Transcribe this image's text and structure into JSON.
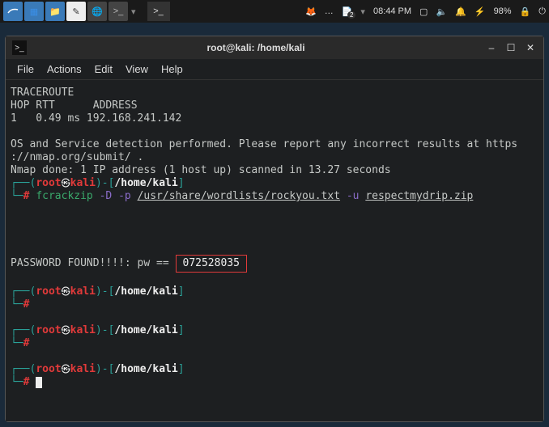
{
  "taskbar": {
    "time": "08:44 PM",
    "battery": "98%",
    "workspace_badge": "2"
  },
  "window": {
    "title": "root@kali: /home/kali"
  },
  "menu": {
    "file": "File",
    "actions": "Actions",
    "edit": "Edit",
    "view": "View",
    "help": "Help"
  },
  "output": {
    "traceroute_header": "TRACEROUTE",
    "traceroute_cols": "HOP RTT      ADDRESS",
    "traceroute_row": "1   0.49 ms 192.168.241.142",
    "os_detect_1": "OS and Service detection performed. Please report any incorrect results at https",
    "os_detect_2": "://nmap.org/submit/ .",
    "nmap_done": "Nmap done: 1 IP address (1 host up) scanned in 13.27 seconds",
    "password_found_label": "PASSWORD FOUND!!!!: pw == ",
    "password_value": "072528035"
  },
  "prompt": {
    "open": "┌──(",
    "user": "root",
    "at": "㉿",
    "host": "kali",
    "close_paren": ")",
    "dash": "-",
    "lb": "[",
    "path": "/home/kali",
    "rb": "]",
    "line2": "└─",
    "hash": "#"
  },
  "cmd": {
    "fcrackzip": "fcrackzip",
    "flag_D": "-D",
    "flag_p": "-p",
    "wordlist": "/usr/share/wordlists/rockyou.txt",
    "flag_u": "-u",
    "zipfile": "respectmydrip.zip"
  }
}
